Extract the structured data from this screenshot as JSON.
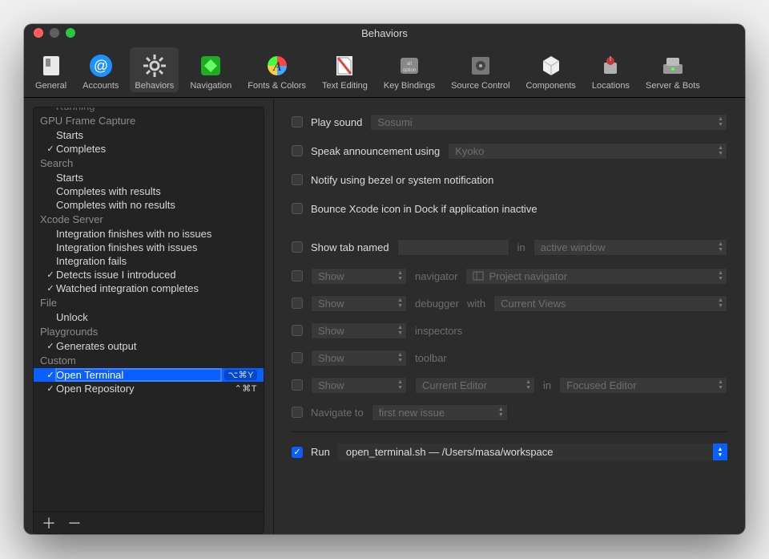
{
  "window": {
    "title": "Behaviors"
  },
  "toolbar": [
    {
      "label": "General"
    },
    {
      "label": "Accounts"
    },
    {
      "label": "Behaviors",
      "selected": true
    },
    {
      "label": "Navigation"
    },
    {
      "label": "Fonts & Colors"
    },
    {
      "label": "Text Editing"
    },
    {
      "label": "Key Bindings"
    },
    {
      "label": "Source Control"
    },
    {
      "label": "Components"
    },
    {
      "label": "Locations"
    },
    {
      "label": "Server & Bots"
    }
  ],
  "sidebar": {
    "truncated_top": "Running",
    "sections": [
      {
        "header": "GPU Frame Capture",
        "items": [
          {
            "label": "Starts",
            "checked": false
          },
          {
            "label": "Completes",
            "checked": true
          }
        ]
      },
      {
        "header": "Search",
        "items": [
          {
            "label": "Starts",
            "checked": false
          },
          {
            "label": "Completes with results",
            "checked": false
          },
          {
            "label": "Completes with no results",
            "checked": false
          }
        ]
      },
      {
        "header": "Xcode Server",
        "items": [
          {
            "label": "Integration finishes with no issues",
            "checked": false
          },
          {
            "label": "Integration finishes with issues",
            "checked": false
          },
          {
            "label": "Integration fails",
            "checked": false
          },
          {
            "label": "Detects issue I introduced",
            "checked": true
          },
          {
            "label": "Watched integration completes",
            "checked": true
          }
        ]
      },
      {
        "header": "File",
        "items": [
          {
            "label": "Unlock",
            "checked": false
          }
        ]
      },
      {
        "header": "Playgrounds",
        "items": [
          {
            "label": "Generates output",
            "checked": true
          }
        ]
      },
      {
        "header": "Custom",
        "items": [
          {
            "label": "Open Terminal",
            "checked": true,
            "selected": true,
            "shortcut": "⌥⌘Y"
          },
          {
            "label": "Open Repository",
            "checked": true,
            "shortcut": "⌃⌘T"
          }
        ]
      }
    ],
    "add": "＋",
    "remove": "－"
  },
  "panel": {
    "play_sound": {
      "label": "Play sound",
      "value": "Sosumi"
    },
    "speak": {
      "label": "Speak announcement using",
      "value": "Kyoko"
    },
    "notify": {
      "label": "Notify using bezel or system notification"
    },
    "bounce": {
      "label": "Bounce Xcode icon in Dock if application inactive"
    },
    "show_tab": {
      "label": "Show tab named",
      "value": "",
      "in": "in",
      "target": "active window"
    },
    "navigator": {
      "action": "Show",
      "label": "navigator",
      "value": "Project navigator"
    },
    "debugger": {
      "action": "Show",
      "label": "debugger",
      "with": "with",
      "value": "Current Views"
    },
    "inspectors": {
      "action": "Show",
      "label": "inspectors"
    },
    "toolbar_row": {
      "action": "Show",
      "label": "toolbar"
    },
    "editor": {
      "action": "Show",
      "value1": "Current Editor",
      "in": "in",
      "value2": "Focused Editor"
    },
    "navigate": {
      "label": "Navigate to",
      "value": "first new issue"
    },
    "run": {
      "label": "Run",
      "value": "open_terminal.sh — /Users/masa/workspace"
    }
  }
}
